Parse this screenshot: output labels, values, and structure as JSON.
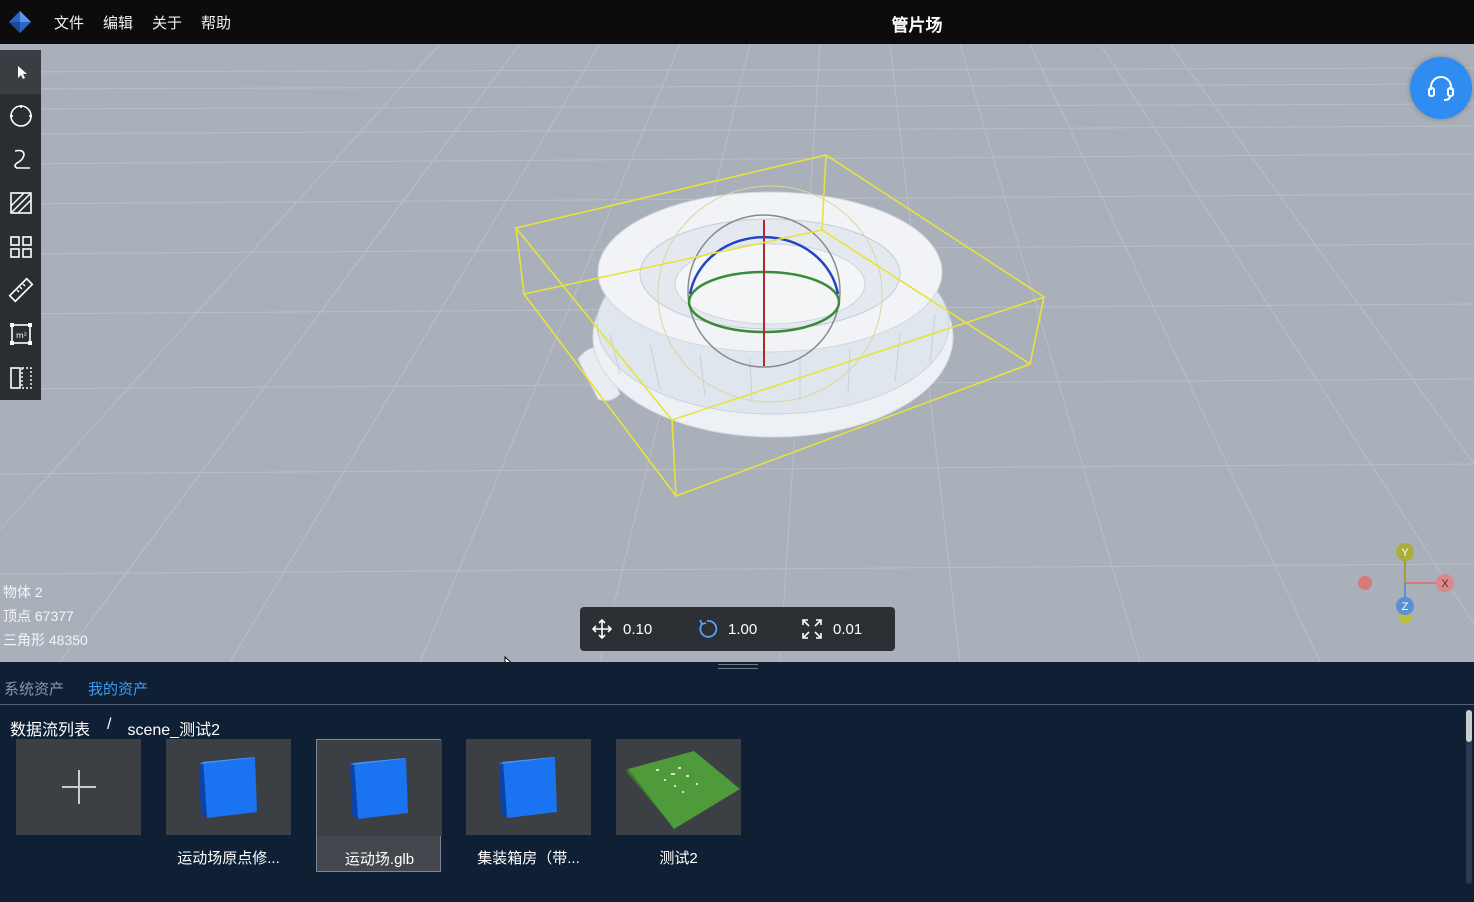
{
  "app": {
    "title": "管片场",
    "menu": [
      "文件",
      "编辑",
      "关于",
      "帮助"
    ]
  },
  "toolbar": {
    "tools": [
      {
        "name": "select-tool",
        "icon": "cursor-icon",
        "active": true
      },
      {
        "name": "circle-tool",
        "icon": "circle-icon"
      },
      {
        "name": "curve-tool",
        "icon": "curve-icon"
      },
      {
        "name": "area-tool",
        "icon": "hatched-rect-icon"
      },
      {
        "name": "grid-tool",
        "icon": "grid-icon"
      },
      {
        "name": "measure-tool",
        "icon": "ruler-icon"
      },
      {
        "name": "area-measure-tool",
        "icon": "square-meter-icon"
      },
      {
        "name": "section-tool",
        "icon": "split-panel-icon"
      }
    ]
  },
  "stats": {
    "objects": "物体 2",
    "vertices": "顶点 67377",
    "triangles": "三角形 48350"
  },
  "transform": {
    "translate": "0.10",
    "rotate": "1.00",
    "scale": "0.01"
  },
  "gizmo": {
    "y": "Y",
    "x": "X",
    "z": "Z"
  },
  "panel": {
    "tabs": [
      "系统资产",
      "我的资产"
    ],
    "active_tab": 1,
    "breadcrumb": {
      "root": "数据流列表",
      "sep": "/",
      "current": "scene_测试2"
    },
    "assets": [
      {
        "label": "",
        "type": "add"
      },
      {
        "label": "运动场原点修...",
        "type": "cube"
      },
      {
        "label": "运动场.glb",
        "type": "cube",
        "selected": true
      },
      {
        "label": "集装箱房（带...",
        "type": "cube"
      },
      {
        "label": "测试2",
        "type": "terrain"
      }
    ]
  },
  "colors": {
    "accent": "#3f9bf2",
    "viewport_bg": "#a9b0ba",
    "panel_bg": "#0f2035",
    "bbox": "#e8e23a"
  }
}
